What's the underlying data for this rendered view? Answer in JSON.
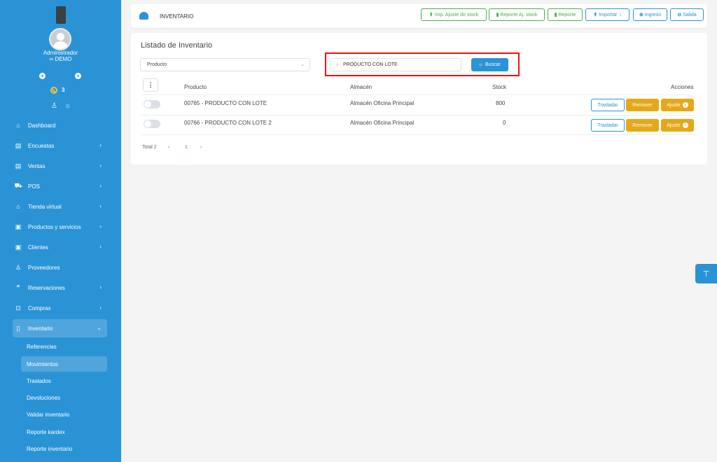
{
  "sidebar": {
    "user_role": "Administrador",
    "user_company": "∞ DEMO",
    "alert_count": "3",
    "items": [
      {
        "label": "Dashboard",
        "icon": "⌂"
      },
      {
        "label": "Encuestas",
        "icon": "▤",
        "chevron": "›"
      },
      {
        "label": "Ventas",
        "icon": "▤",
        "chevron": "›"
      },
      {
        "label": "POS",
        "icon": "⛟",
        "chevron": "›"
      },
      {
        "label": "Tienda virtual",
        "icon": "⌂",
        "chevron": "›"
      },
      {
        "label": "Productos y servicios",
        "icon": "▣",
        "chevron": "›"
      },
      {
        "label": "Clientes",
        "icon": "▣",
        "chevron": "›"
      },
      {
        "label": "Proveedores",
        "icon": "♙"
      },
      {
        "label": "Reservaciones",
        "icon": "❞",
        "chevron": "›"
      },
      {
        "label": "Compras",
        "icon": "⊡",
        "chevron": "›"
      },
      {
        "label": "Inventario",
        "icon": "▯",
        "chevron": "⌄"
      }
    ],
    "sub_items": [
      "Referencias",
      "Movimientos",
      "Traslados",
      "Devoluciones",
      "Validar inventario",
      "Reporte kardex",
      "Reporte inventario"
    ]
  },
  "header": {
    "title": "INVENTARIO",
    "buttons": [
      {
        "label": "Imp. Ajuste de stock",
        "icon": "⬆"
      },
      {
        "label": "Reporte Aj. stock",
        "icon": "▮"
      },
      {
        "label": "Reporte",
        "icon": "▮"
      },
      {
        "label": "Importar",
        "icon": "⬆",
        "suffix": "›"
      },
      {
        "label": "Ingreso",
        "icon": "⊕"
      },
      {
        "label": "Salida",
        "icon": "⊖"
      }
    ]
  },
  "main": {
    "card_title": "Listado de Inventario",
    "filter_select": "Producto",
    "search_value": "PRODUCTO CON LOTE",
    "search_button": "Buscar",
    "columns_menu": "⋮",
    "table": {
      "headers": [
        "Producto",
        "Almacén",
        "Stock",
        "Acciones"
      ],
      "rows": [
        {
          "producto": "00765 - PRODUCTO CON LOTE",
          "almacen": "Almacén Oficina Principal",
          "stock": "800"
        },
        {
          "producto": "00766 - PRODUCTO CON LOTE 2",
          "almacen": "Almacén Oficina Principal",
          "stock": "0"
        }
      ],
      "actions": {
        "trasladar": "Trasladar",
        "remover": "Remover",
        "ajuste": "Ajuste",
        "info": "i"
      }
    },
    "pagination": {
      "total": "Total 2",
      "prev": "‹",
      "page": "1",
      "next": "›"
    }
  },
  "colors": {
    "primary": "#2a93d5",
    "success": "#4caf50",
    "warning": "#e6a817",
    "highlight": "#ee1111"
  }
}
